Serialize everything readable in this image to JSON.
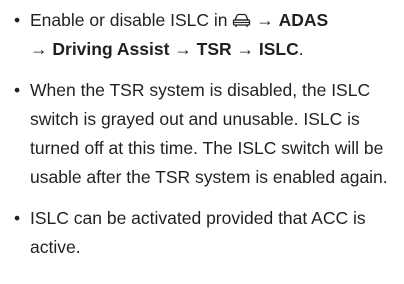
{
  "instructions": {
    "bullet_char": "•",
    "items": [
      {
        "segments": [
          {
            "text": "Enable or disable ISLC in ",
            "bold": false
          },
          {
            "icon": "car-icon"
          },
          {
            "text": " → ",
            "bold": false
          },
          {
            "text": "ADAS",
            "bold": true
          },
          {
            "text": " → ",
            "bold": false
          },
          {
            "text": "Driving Assist",
            "bold": true
          },
          {
            "text": " → ",
            "bold": false
          },
          {
            "text": "TSR",
            "bold": true
          },
          {
            "text": " → ",
            "bold": false
          },
          {
            "text": "ISLC",
            "bold": true
          },
          {
            "text": ".",
            "bold": false
          }
        ]
      },
      {
        "segments": [
          {
            "text": "When the TSR system is disabled, the ISLC switch is grayed out and unusable. ISLC is turned off at this time. The ISLC switch will be usable after the TSR system is enabled again.",
            "bold": false
          }
        ]
      },
      {
        "segments": [
          {
            "text": "ISLC can be activated provided that ACC is active.",
            "bold": false
          }
        ]
      }
    ]
  }
}
